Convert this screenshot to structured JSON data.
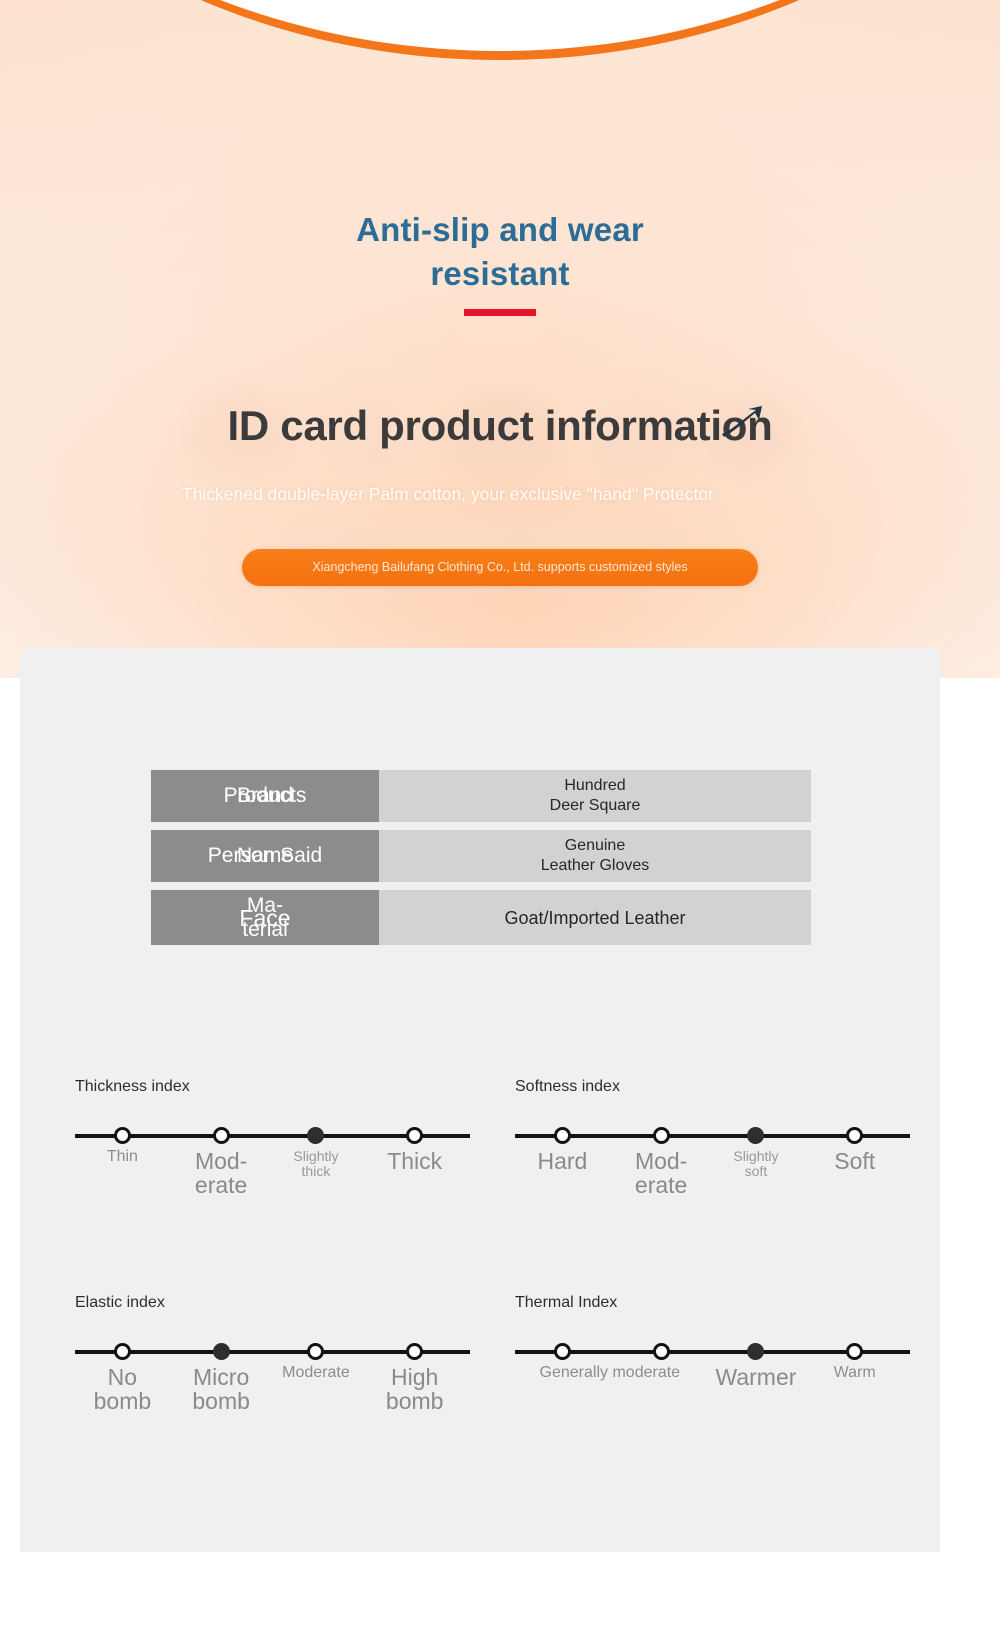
{
  "hero": {
    "title": "Anti-slip and wear\nresistant",
    "heading": "ID card product information",
    "subheading": "Thickened double-layer Palm cotton, your exclusive \"hand\" Protector",
    "cta": "Xiangcheng Bailufang Clothing Co., Ltd. supports customized styles",
    "colors": {
      "title": "#2b6d96",
      "rule": "#e8132b",
      "dome_rim": "#f4761b",
      "cta_bg": "#f87915"
    }
  },
  "spec_table": {
    "rows": [
      {
        "label_en": "Products",
        "label_overlay": "Brand",
        "value": "Hundred\nDeer Square"
      },
      {
        "label_en": "Name",
        "label_overlay": "Person Said",
        "value": "Genuine\nLeather Gloves"
      },
      {
        "label_en": "Face",
        "label_overlay": "Ma-\nterial",
        "value": "Goat/Imported Leather"
      }
    ]
  },
  "indices": [
    {
      "title": "Thickness index",
      "active": 2,
      "labels": [
        {
          "text": "Thin",
          "size": "mid"
        },
        {
          "text": "Mod-\nerate",
          "size": "big"
        },
        {
          "text": "Slightly\nthick",
          "size": "small"
        },
        {
          "text": "Thick",
          "size": "big"
        }
      ]
    },
    {
      "title": "Softness index",
      "active": 2,
      "labels": [
        {
          "text": "Hard",
          "size": "big"
        },
        {
          "text": "Mod-\nerate",
          "size": "big"
        },
        {
          "text": "Slightly\nsoft",
          "size": "small"
        },
        {
          "text": "Soft",
          "size": "big"
        }
      ]
    },
    {
      "title": "Elastic index",
      "active": 1,
      "labels": [
        {
          "text": "No\nbomb",
          "size": "big"
        },
        {
          "text": "Micro\nbomb",
          "size": "big"
        },
        {
          "text": "Moderate",
          "size": "mid"
        },
        {
          "text": "High\nbomb",
          "size": "big"
        }
      ]
    },
    {
      "title": "Thermal Index",
      "active": 2,
      "labels": [
        {
          "text": "Generally moderate",
          "size": "mid"
        },
        {
          "text": "",
          "size": "mid"
        },
        {
          "text": "Warmer",
          "size": "big"
        },
        {
          "text": "Warm",
          "size": "mid"
        }
      ]
    }
  ]
}
